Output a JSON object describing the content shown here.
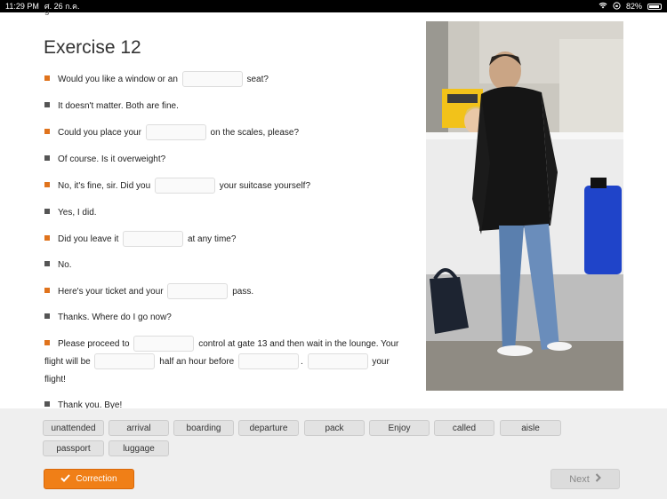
{
  "status_bar": {
    "time": "11:29 PM",
    "date": "ศ. 26 ก.ค.",
    "battery": "82%",
    "battery_level": 0.82
  },
  "exercise": {
    "title": "Exercise 12",
    "lines": [
      {
        "segments": [
          "Would you like a window or an",
          "seat?"
        ]
      },
      {
        "segments": [
          "It doesn't matter. Both are fine."
        ]
      },
      {
        "segments": [
          "Could you place your",
          "on the scales, please?"
        ]
      },
      {
        "segments": [
          "Of course. Is it overweight?"
        ]
      },
      {
        "segments": [
          "No, it's fine, sir.  Did you",
          "your suitcase yourself?"
        ]
      },
      {
        "segments": [
          "Yes, I did."
        ]
      },
      {
        "segments": [
          "Did you leave it",
          "at any time?"
        ]
      },
      {
        "segments": [
          "No."
        ]
      },
      {
        "segments": [
          "Here's your ticket and your",
          "pass."
        ]
      },
      {
        "segments": [
          "Thanks. Where do I go now?"
        ]
      },
      {
        "segments": [
          "Please proceed to",
          "control at gate 13 and then wait in the lounge. Your",
          "flight will be",
          "half an hour before",
          ".",
          "your",
          "flight!"
        ]
      },
      {
        "segments": [
          "Thank you. Bye!"
        ]
      }
    ]
  },
  "word_bank": [
    "unattended",
    "arrival",
    "boarding",
    "departure",
    "pack",
    "Enjoy",
    "called",
    "aisle",
    "passport",
    "luggage"
  ],
  "buttons": {
    "correction": "Correction",
    "next": "Next"
  },
  "colors": {
    "accent": "#f07f17",
    "speaker_a": "#e0731c",
    "speaker_b": "#555555"
  }
}
